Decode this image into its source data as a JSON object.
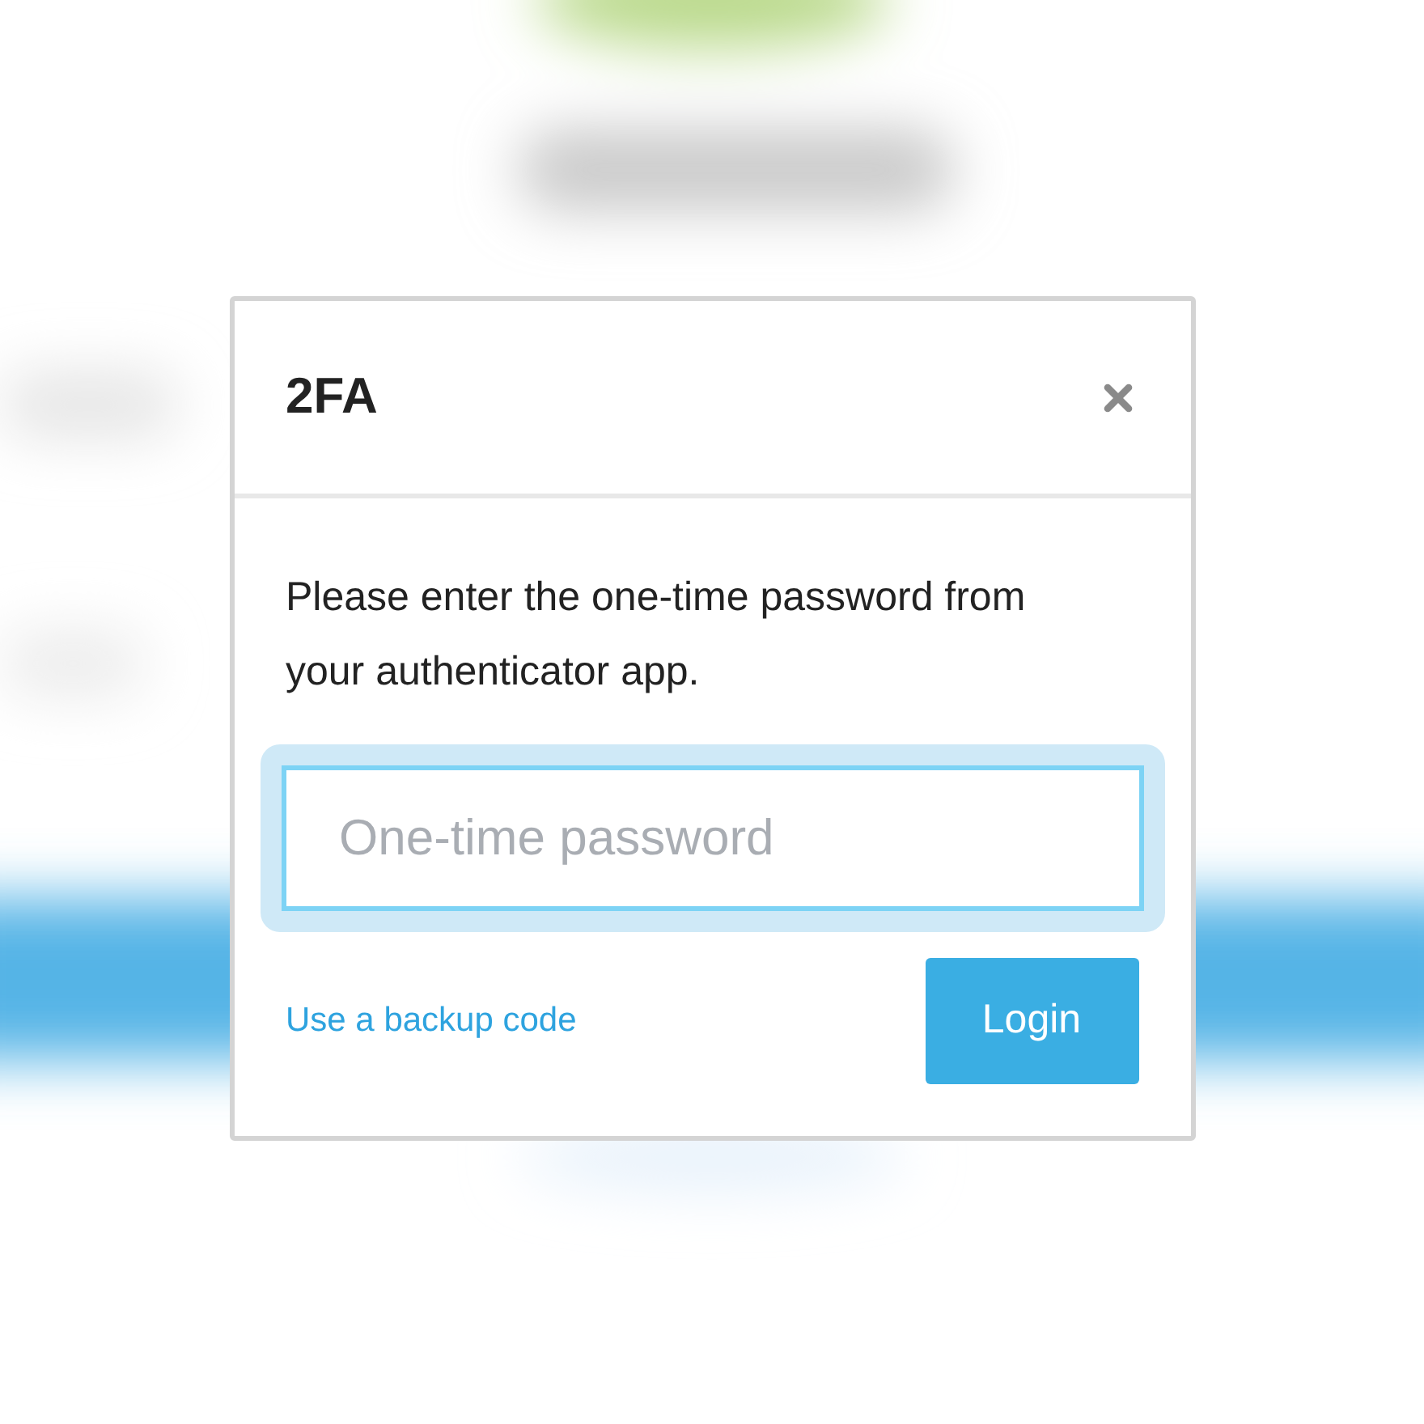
{
  "dialog": {
    "title": "2FA",
    "message": "Please enter the one-time password from your authenticator app.",
    "otp_field": {
      "placeholder": "One-time password",
      "focused": true
    },
    "backup_link": "Use a backup code",
    "login_button": "Login"
  }
}
